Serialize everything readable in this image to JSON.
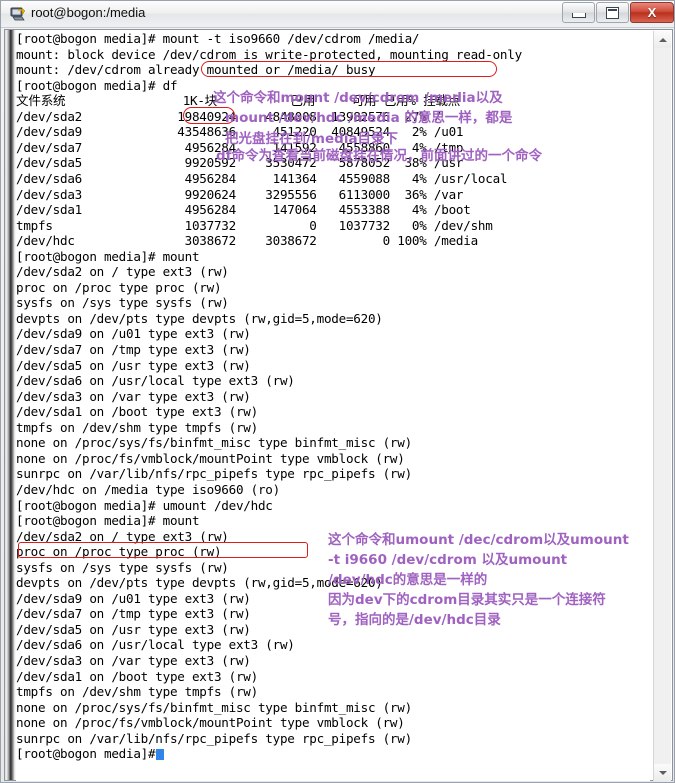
{
  "window": {
    "title": "root@bogon:/media",
    "icon": "putty-terminal-icon",
    "controls": [
      {
        "name": "minimize-button",
        "label": "–"
      },
      {
        "name": "restore-button",
        "label": "❐"
      },
      {
        "name": "close-button",
        "label": "X"
      }
    ]
  },
  "terminal": {
    "prompt": "[root@bogon media]#",
    "cursor_visible": true,
    "lines": [
      "[root@bogon media]# mount -t iso9660 /dev/cdrom /media/",
      "mount: block device /dev/cdrom is write-protected, mounting read-only",
      "mount: /dev/cdrom already mounted or /media/ busy",
      "[root@bogon media]# df",
      "文件系统                1K-块          已用     可用 已用% 挂载点",
      "/dev/sda2             19840924    4848008  13982576  27% /",
      "/dev/sda9             43548636     451220  40849524   2% /u01",
      "/dev/sda7              4956284     141592   4558860   4% /tmp",
      "/dev/sda5              9920592    3530472   5878052  38% /usr",
      "/dev/sda6              4956284     141364   4559088   4% /usr/local",
      "/dev/sda3              9920624    3295556   6113000  36% /var",
      "/dev/sda1              4956284     147064   4553388   4% /boot",
      "tmpfs                  1037732          0   1037732   0% /dev/shm",
      "/dev/hdc               3038672    3038672         0 100% /media",
      "[root@bogon media]# mount",
      "/dev/sda2 on / type ext3 (rw)",
      "proc on /proc type proc (rw)",
      "sysfs on /sys type sysfs (rw)",
      "devpts on /dev/pts type devpts (rw,gid=5,mode=620)",
      "/dev/sda9 on /u01 type ext3 (rw)",
      "/dev/sda7 on /tmp type ext3 (rw)",
      "/dev/sda5 on /usr type ext3 (rw)",
      "/dev/sda6 on /usr/local type ext3 (rw)",
      "/dev/sda3 on /var type ext3 (rw)",
      "/dev/sda1 on /boot type ext3 (rw)",
      "tmpfs on /dev/shm type tmpfs (rw)",
      "none on /proc/sys/fs/binfmt_misc type binfmt_misc (rw)",
      "none on /proc/fs/vmblock/mountPoint type vmblock (rw)",
      "sunrpc on /var/lib/nfs/rpc_pipefs type rpc_pipefs (rw)",
      "/dev/hdc on /media type iso9660 (ro)",
      "[root@bogon media]# umount /dev/hdc",
      "[root@bogon media]# mount",
      "/dev/sda2 on / type ext3 (rw)",
      "proc on /proc type proc (rw)",
      "sysfs on /sys type sysfs (rw)",
      "devpts on /dev/pts type devpts (rw,gid=5,mode=620)",
      "/dev/sda9 on /u01 type ext3 (rw)",
      "/dev/sda7 on /tmp type ext3 (rw)",
      "/dev/sda5 on /usr type ext3 (rw)",
      "/dev/sda6 on /usr/local type ext3 (rw)",
      "/dev/sda3 on /var type ext3 (rw)",
      "/dev/sda1 on /boot type ext3 (rw)",
      "tmpfs on /dev/shm type tmpfs (rw)",
      "none on /proc/sys/fs/binfmt_misc type binfmt_misc (rw)",
      "none on /proc/fs/vmblock/mountPoint type vmblock (rw)",
      "sunrpc on /var/lib/nfs/rpc_pipefs type rpc_pipefs (rw)",
      "[root@bogon media]# "
    ]
  },
  "annotations": {
    "color": "#a062c0",
    "highlight_color": "#e01b1b",
    "group_mount": [
      "这个命令和mount /dev/cdrom /media以及",
      "mount /dev/hdc /media 的意思一样，都是",
      "把光盘挂在到/media目录下"
    ],
    "group_df": [
      "df命令为查看当前磁盘挂在情况，前面讲过的一个命令"
    ],
    "group_umount": [
      "这个命令和umount /dec/cdrom以及umount",
      "-t i9660 /dev/cdrom 以及umount",
      "/dev/hdc的意思是一样的",
      "因为dev下的cdrom目录其实只是一个连接符",
      "号，指向的是/dev/hdc目录"
    ]
  }
}
